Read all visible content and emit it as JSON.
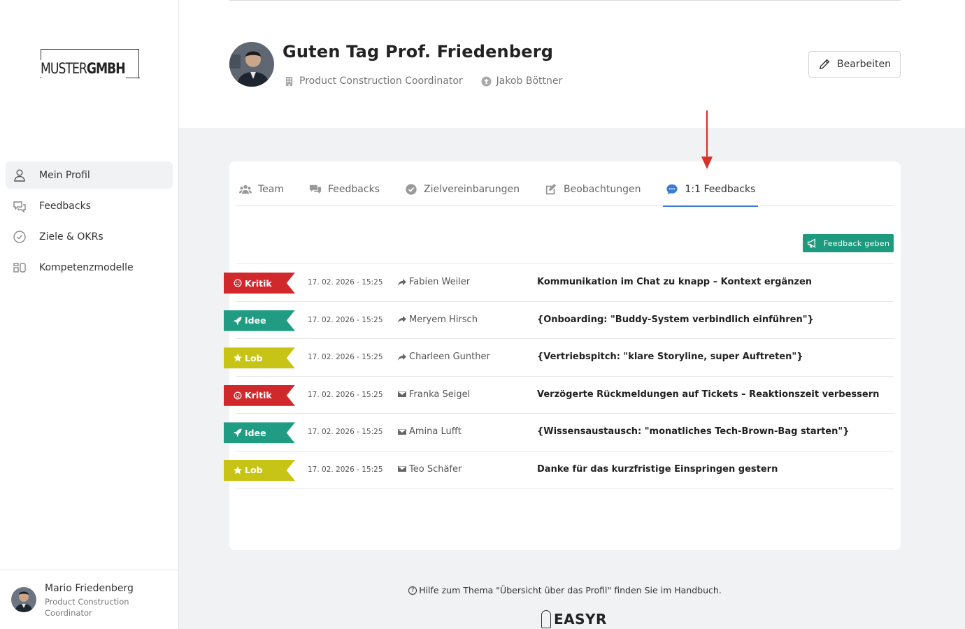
{
  "sidebar": {
    "logo": {
      "part1": "MUSTER",
      "part2": "GMBH"
    },
    "items": [
      {
        "label": "Mein Profil",
        "icon": "person-icon",
        "active": true
      },
      {
        "label": "Feedbacks",
        "icon": "chat-icon",
        "active": false
      },
      {
        "label": "Ziele & OKRs",
        "icon": "check-circle-icon",
        "active": false
      },
      {
        "label": "Kompetenzmodelle",
        "icon": "model-icon",
        "active": false
      }
    ],
    "user": {
      "name": "Mario Friedenberg",
      "role": "Product Construction Coordinator"
    }
  },
  "header": {
    "greeting": "Guten Tag Prof. Friedenberg",
    "position": "Product Construction Coordinator",
    "manager": "Jakob Böttner",
    "edit_label": "Bearbeiten"
  },
  "tabs": [
    {
      "label": "Team",
      "icon": "users-icon",
      "active": false
    },
    {
      "label": "Feedbacks",
      "icon": "comments-icon",
      "active": false
    },
    {
      "label": "Zielvereinbarungen",
      "icon": "check-circle-icon",
      "active": false
    },
    {
      "label": "Beobachtungen",
      "icon": "edit-icon",
      "active": false
    },
    {
      "label": "1:1 Feedbacks",
      "icon": "chat-bubble-icon",
      "active": true
    }
  ],
  "feedback_button": "Feedback geben",
  "rows": [
    {
      "type": "Kritik",
      "kind": "kritik",
      "date": "17. 02. 2026 - 15:25",
      "channel": "share",
      "person": "Fabien Weiler",
      "subject": "Kommunikation im Chat zu knapp – Kontext ergänzen"
    },
    {
      "type": "Idee",
      "kind": "idee",
      "date": "17. 02. 2026 - 15:25",
      "channel": "share",
      "person": "Meryem Hirsch",
      "subject": "{Onboarding: \"Buddy-System verbindlich einführen\"}"
    },
    {
      "type": "Lob",
      "kind": "lob",
      "date": "17. 02. 2026 - 15:25",
      "channel": "share",
      "person": "Charleen Gunther",
      "subject": "{Vertriebspitch: \"klare Storyline, super Auftreten\"}"
    },
    {
      "type": "Kritik",
      "kind": "kritik",
      "date": "17. 02. 2026 - 15:25",
      "channel": "mail",
      "person": "Franka Seigel",
      "subject": "Verzögerte Rückmeldungen auf Tickets – Reaktionszeit verbessern"
    },
    {
      "type": "Idee",
      "kind": "idee",
      "date": "17. 02. 2026 - 15:25",
      "channel": "mail",
      "person": "Amina Lufft",
      "subject": "{Wissensaustausch: \"monatliches Tech-Brown-Bag starten\"}"
    },
    {
      "type": "Lob",
      "kind": "lob",
      "date": "17. 02. 2026 - 15:25",
      "channel": "mail",
      "person": "Teo Schäfer",
      "subject": "Danke für das kurzfristige Einspringen gestern"
    }
  ],
  "help": "Hilfe zum Thema \"Übersicht über das Profil\" finden Sie im Handbuch.",
  "footer_brand": "EASYR",
  "colors": {
    "kritik": "#d0282b",
    "idee": "#1f9c82",
    "lob": "#c8c416",
    "accent": "#3a7bd5",
    "button": "#1e9a7e",
    "arrow": "#d9322b"
  }
}
